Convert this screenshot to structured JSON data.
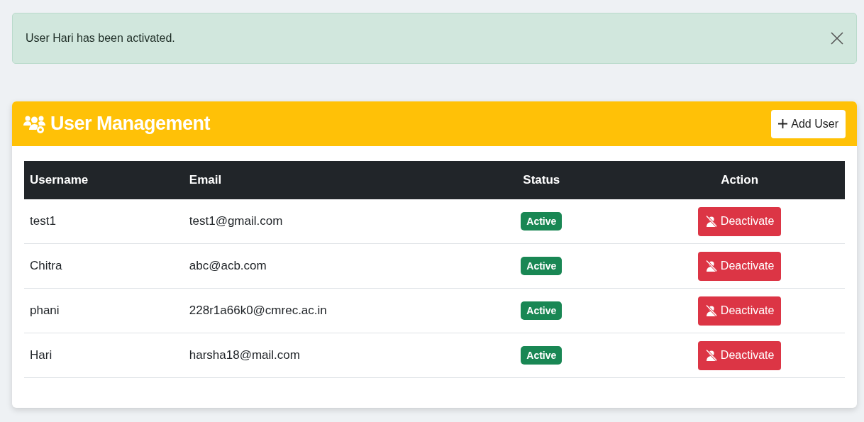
{
  "alert": {
    "message": "User Hari has been activated."
  },
  "card": {
    "title": "User Management",
    "add_button": "Add User"
  },
  "table": {
    "columns": [
      "Username",
      "Email",
      "Status",
      "Action"
    ],
    "rows": [
      {
        "username": "test1",
        "email": "test1@gmail.com",
        "status": "Active",
        "action": "Deactivate"
      },
      {
        "username": "Chitra",
        "email": "abc@acb.com",
        "status": "Active",
        "action": "Deactivate"
      },
      {
        "username": "phani",
        "email": "228r1a66k0@cmrec.ac.in",
        "status": "Active",
        "action": "Deactivate"
      },
      {
        "username": "Hari",
        "email": "harsha18@mail.com",
        "status": "Active",
        "action": "Deactivate"
      }
    ]
  }
}
